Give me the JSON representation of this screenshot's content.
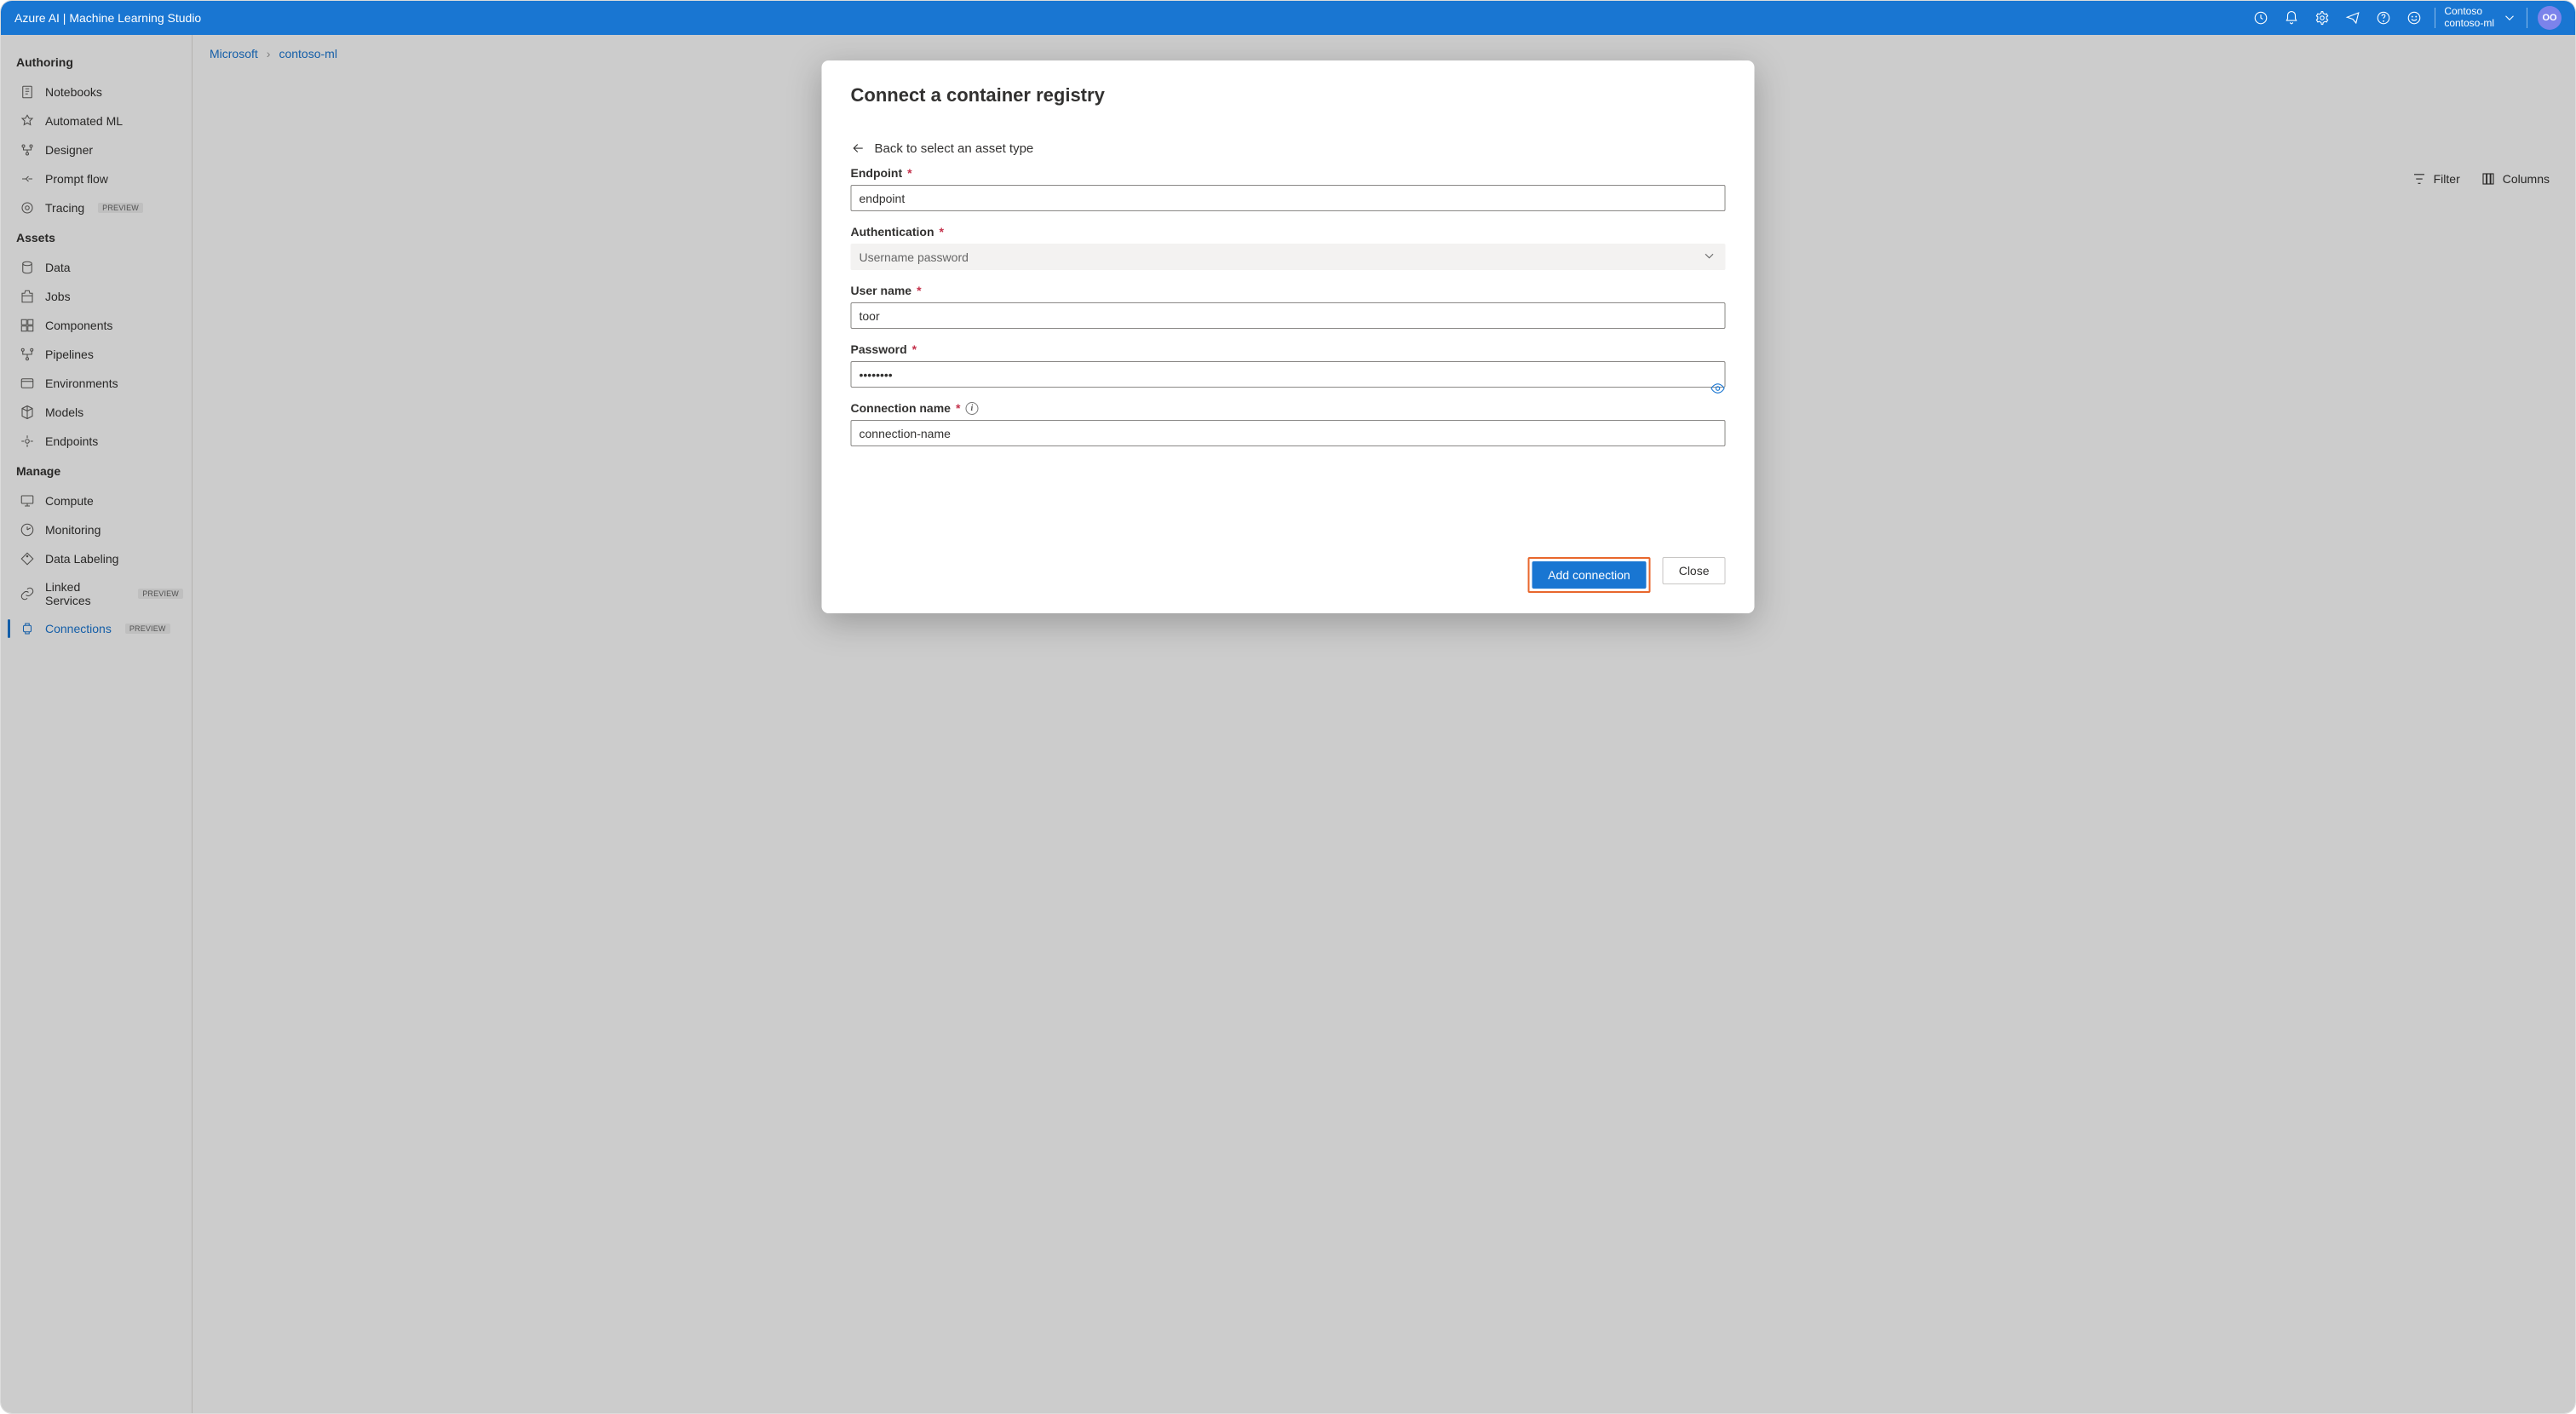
{
  "topbar": {
    "brand": "Azure AI | Machine Learning Studio",
    "workspace_directory": "Contoso",
    "workspace_name": "contoso-ml",
    "avatar_initials": "OO"
  },
  "sidebar": {
    "sections": [
      {
        "title": "Authoring",
        "items": [
          {
            "icon": "notebook-icon",
            "label": "Notebooks"
          },
          {
            "icon": "automl-icon",
            "label": "Automated ML"
          },
          {
            "icon": "designer-icon",
            "label": "Designer"
          },
          {
            "icon": "promptflow-icon",
            "label": "Prompt flow"
          },
          {
            "icon": "tracing-icon",
            "label": "Tracing",
            "preview": true
          }
        ]
      },
      {
        "title": "Assets",
        "items": [
          {
            "icon": "data-icon",
            "label": "Data"
          },
          {
            "icon": "jobs-icon",
            "label": "Jobs"
          },
          {
            "icon": "components-icon",
            "label": "Components"
          },
          {
            "icon": "pipelines-icon",
            "label": "Pipelines"
          },
          {
            "icon": "environments-icon",
            "label": "Environments"
          },
          {
            "icon": "models-icon",
            "label": "Models"
          },
          {
            "icon": "endpoints-icon",
            "label": "Endpoints"
          }
        ]
      },
      {
        "title": "Manage",
        "items": [
          {
            "icon": "compute-icon",
            "label": "Compute"
          },
          {
            "icon": "monitoring-icon",
            "label": "Monitoring"
          },
          {
            "icon": "datalabeling-icon",
            "label": "Data Labeling"
          },
          {
            "icon": "linkedservices-icon",
            "label": "Linked Services",
            "preview": true
          },
          {
            "icon": "connections-icon",
            "label": "Connections",
            "preview": true,
            "active": true
          }
        ]
      }
    ]
  },
  "breadcrumb": {
    "items": [
      {
        "label": "Microsoft"
      },
      {
        "label": "contoso-ml"
      }
    ]
  },
  "toolbar": {
    "filter_label": "Filter",
    "columns_label": "Columns"
  },
  "modal": {
    "title": "Connect a container registry",
    "back_label": "Back to select an asset type",
    "fields": {
      "endpoint": {
        "label": "Endpoint",
        "value": "endpoint"
      },
      "authentication": {
        "label": "Authentication",
        "value": "Username password"
      },
      "username": {
        "label": "User name",
        "value": "toor"
      },
      "password": {
        "label": "Password",
        "value": "••••••••"
      },
      "connection_name": {
        "label": "Connection name",
        "value": "connection-name"
      }
    },
    "buttons": {
      "primary": "Add connection",
      "secondary": "Close"
    }
  },
  "preview_badge": "PREVIEW"
}
